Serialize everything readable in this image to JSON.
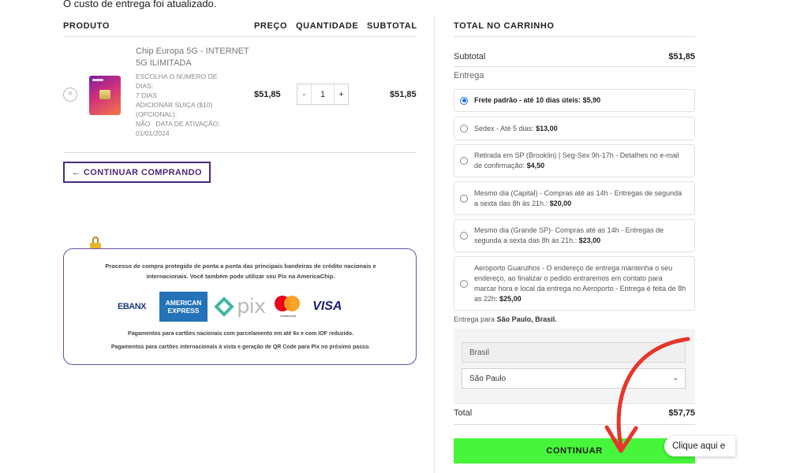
{
  "notice": "O custo de entrega foi atualizado.",
  "cart": {
    "headers": {
      "product": "PRODUTO",
      "price": "PREÇO",
      "quantity": "QUANTIDADE",
      "subtotal": "SUBTOTAL"
    },
    "item": {
      "remove_symbol": "×",
      "name": "Chip Europa 5G - INTERNET 5G ILIMITADA",
      "meta": [
        "ESCOLHA O NÚMERO DE",
        "DIAS:",
        "7 DIAS",
        "ADICIONAR SUIÇA ($10)",
        "(OPCIONAL):",
        "NÃO   DATA DE ATIVAÇÃO:",
        "01/01/2024"
      ],
      "price": "$51,85",
      "qty_minus": "-",
      "qty_value": "1",
      "qty_plus": "+",
      "subtotal": "$51,85"
    },
    "continue_shopping": "← CONTINUAR COMPRANDO"
  },
  "secure": {
    "text": "Processo de compra protegido de ponta a ponta das principais bandeiras de crédito nacionais e internacionais. Você também pode utilizar seu Pix na AmericaChip.",
    "logos": {
      "ebanx": "EBANX",
      "amex_line1": "AMERICAN",
      "amex_line2": "EXPRESS",
      "pix": "pix",
      "mastercard": "mastercard",
      "visa": "VISA"
    },
    "note1": "Pagamentos para cartões nacionais com parcelamento em até 6x e com IOF reduzido.",
    "note2": "Pagamentos para cartões internacionais à vista e geração de QR Code para Pix no próximo passo."
  },
  "totals": {
    "title": "TOTAL NO CARRINHO",
    "subtotal_label": "Subtotal",
    "subtotal_value": "$51,85",
    "shipping_label": "Entrega",
    "options": [
      {
        "text": "Frete padrão - até 10 dias úteis:",
        "price": "$5,90",
        "selected": true
      },
      {
        "text": "Sedex - Até 5 dias:",
        "price": "$13,00",
        "selected": false
      },
      {
        "text": "Retirada em SP (Brooklin) | Seg-Sex 9h-17h - Detalhes no e-mail de confirmação:",
        "price": "$4,50",
        "selected": false
      },
      {
        "text": "Mesmo dia (Capital) - Compras até as 14h - Entregas de segunda a sexta das 8h às 21h.:",
        "price": "$20,00",
        "selected": false
      },
      {
        "text": "Mesmo dia (Grande SP)- Compras até as 14h - Entregas de segunda a sexta das 8h às 21h.:",
        "price": "$23,00",
        "selected": false
      },
      {
        "text": "Aeroporto Guarulhos - O endereço de entrega mantenha o seu endereço, ao finalizar o pedido entraremos em contato para marcar hora e local da entrega no Aeroporto - Entrega é feita de 8h as 22h:",
        "price": "$25,00",
        "selected": false
      }
    ],
    "ship_dest_prefix": "Entrega para",
    "ship_dest": "São Paulo, Brasil.",
    "country_value": "Brasil",
    "state_value": "São Paulo",
    "state_chevron": "⌄",
    "total_label": "Total",
    "total_value": "$57,75",
    "continue_button": "CONTINUAR"
  },
  "chat": {
    "label": "Clique aqui e"
  },
  "colors": {
    "accent_purple": "#4b2a7c",
    "continue_green": "#47f53a",
    "annotation_red": "#e8352b",
    "radio_blue": "#1e73e8"
  },
  "icons": {
    "remove": "close-circle-icon",
    "lock": "padlock-icon",
    "chevron": "chevron-down-icon",
    "arrow": "curved-arrow-annotation"
  }
}
